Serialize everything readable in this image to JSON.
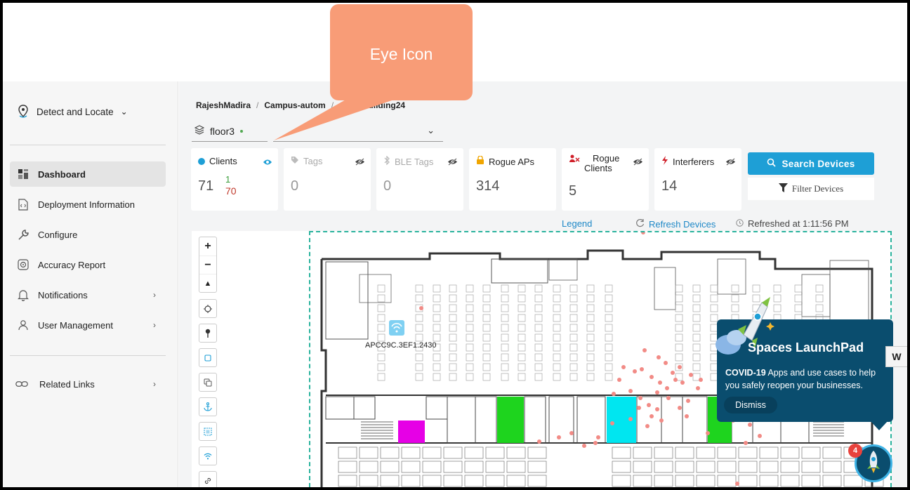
{
  "callout": {
    "text": "Eye Icon"
  },
  "sidebar": {
    "app_title": "Detect and Locate",
    "items": [
      {
        "label": "Dashboard",
        "icon": "dashboard-icon",
        "active": true
      },
      {
        "label": "Deployment Information",
        "icon": "document-code-icon"
      },
      {
        "label": "Configure",
        "icon": "wrench-icon"
      },
      {
        "label": "Accuracy Report",
        "icon": "target-icon"
      },
      {
        "label": "Notifications",
        "icon": "bell-icon",
        "has_submenu": true
      },
      {
        "label": "User Management",
        "icon": "user-icon",
        "has_submenu": true
      }
    ],
    "related_links": "Related Links"
  },
  "breadcrumb": [
    "RajeshMadira",
    "Campus-autom",
    "CiscoBuilding24"
  ],
  "floor": {
    "selected": "floor3"
  },
  "cards": {
    "clients": {
      "title": "Clients",
      "value": "71",
      "sub_green": "1",
      "sub_red": "70"
    },
    "tags": {
      "title": "Tags",
      "value": "0"
    },
    "ble_tags": {
      "title": "BLE Tags",
      "value": "0"
    },
    "rogue_aps": {
      "title": "Rogue APs",
      "value": "314"
    },
    "rogue_clients": {
      "title": "Rogue Clients",
      "value": "5"
    },
    "interferers": {
      "title": "Interferers",
      "value": "14"
    }
  },
  "actions": {
    "search": "Search Devices",
    "filter": "Filter Devices"
  },
  "status": {
    "legend": "Legend",
    "refresh": "Refresh Devices",
    "refreshed": "Refreshed at 1:11:56 PM"
  },
  "map": {
    "ap_label": "APCC9C.3EF1.2430"
  },
  "launchpad": {
    "title": "Spaces LaunchPad",
    "body_bold": "COVID-19",
    "body": " Apps and use cases to help you safely reopen your businesses.",
    "dismiss": "Dismiss",
    "badge": "4"
  },
  "colors": {
    "accent": "#1e9fd6",
    "callout": "#f89c77",
    "launchpad": "#0a4d6e",
    "magenta": "#e600e6",
    "green": "#1ed41e",
    "cyan": "#00e6f0",
    "device_dot": "#f28b86"
  }
}
